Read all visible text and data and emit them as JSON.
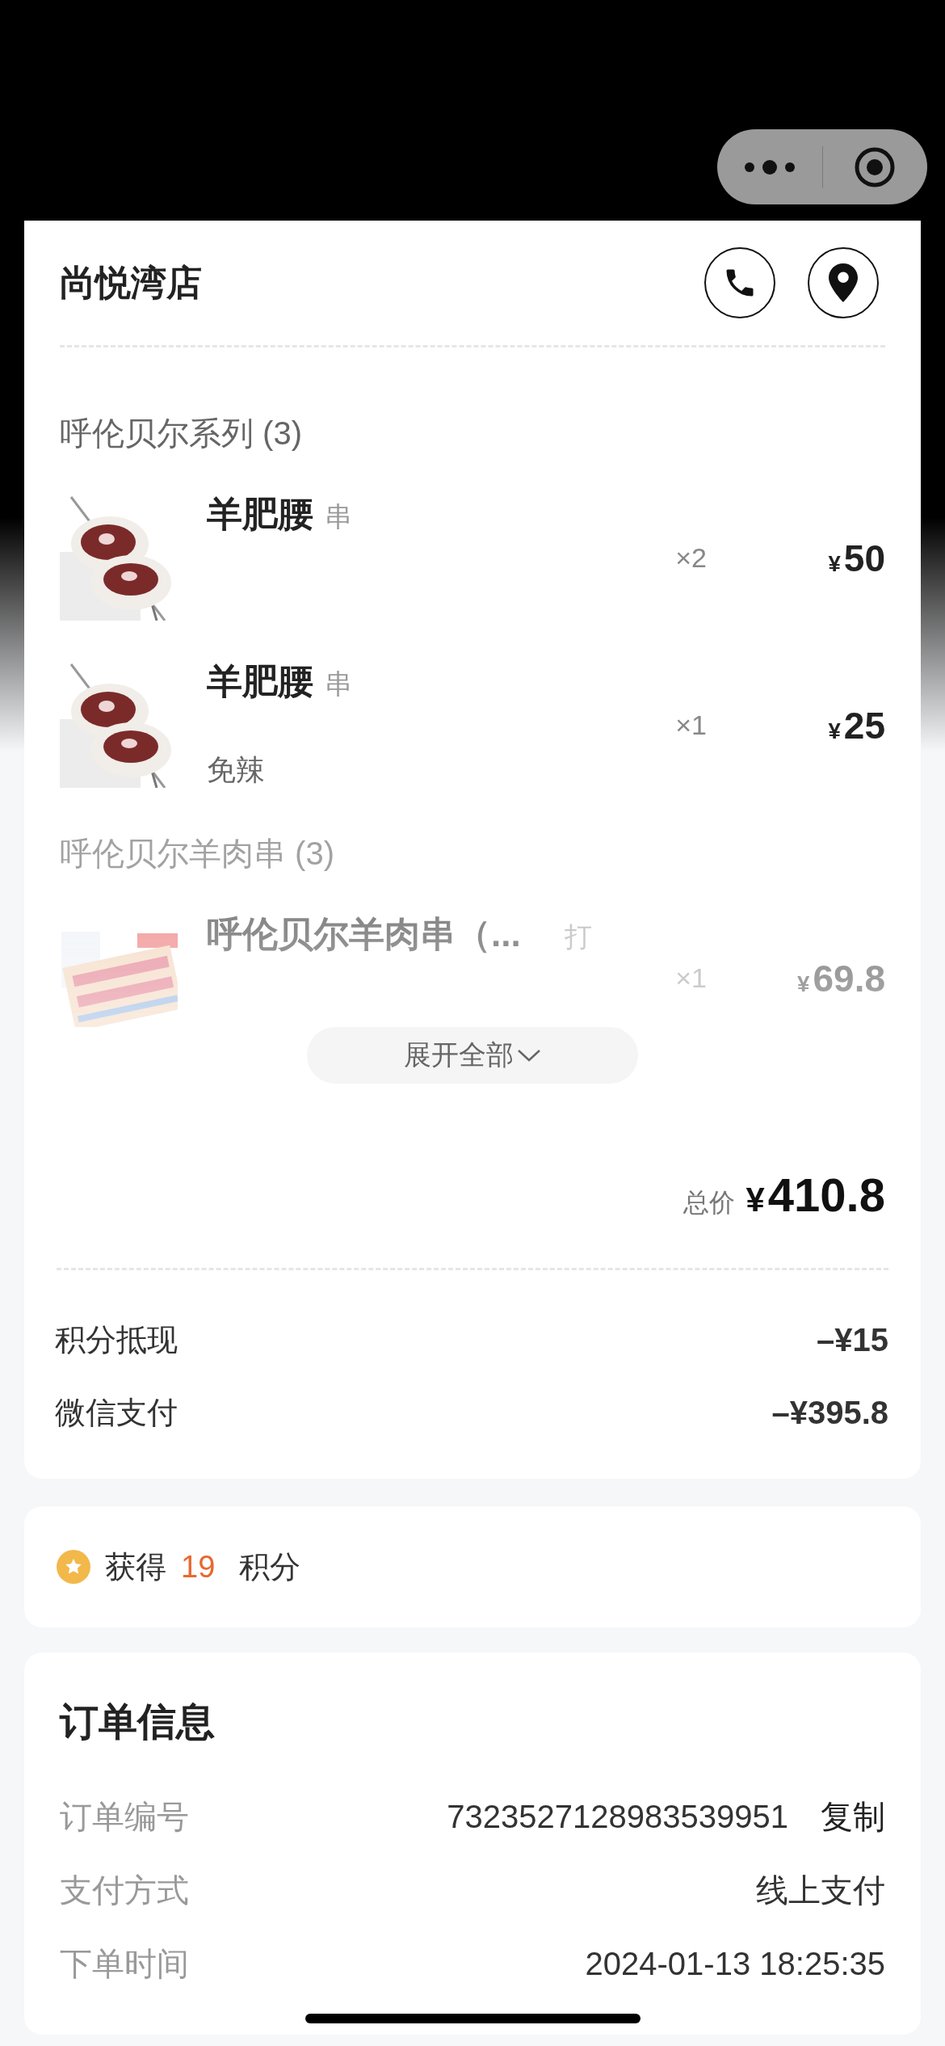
{
  "store": {
    "name": "尚悦湾店"
  },
  "groups": [
    {
      "title": "呼伦贝尔系列 (3)",
      "faded": false,
      "items": [
        {
          "name": "羊肥腰",
          "unit": "串",
          "quantity": "×2",
          "currency": "¥",
          "amount": "50"
        },
        {
          "name": "羊肥腰",
          "unit": "串",
          "spec": "免辣",
          "quantity": "×1",
          "currency": "¥",
          "amount": "25"
        }
      ]
    },
    {
      "title": "呼伦贝尔羊肉串 (3)",
      "faded": true,
      "items": [
        {
          "name": "呼伦贝尔羊肉串（...",
          "unit": "打",
          "quantity": "×1",
          "currency": "¥",
          "amount": "69.8"
        }
      ]
    }
  ],
  "expand_button": {
    "label": "展开全部"
  },
  "total": {
    "label": "总价",
    "currency": "¥",
    "amount": "410.8"
  },
  "payments": [
    {
      "label": "积分抵现",
      "amount": "–¥15"
    },
    {
      "label": "微信支付",
      "amount": "–¥395.8"
    }
  ],
  "points": {
    "prefix": "获得",
    "value": "19",
    "suffix": "积分"
  },
  "order_info": {
    "title": "订单信息",
    "rows": [
      {
        "label": "订单编号",
        "value": "7323527128983539951",
        "action": "复制"
      },
      {
        "label": "支付方式",
        "value": "线上支付"
      },
      {
        "label": "下单时间",
        "value": "2024-01-13 18:25:35"
      }
    ]
  }
}
